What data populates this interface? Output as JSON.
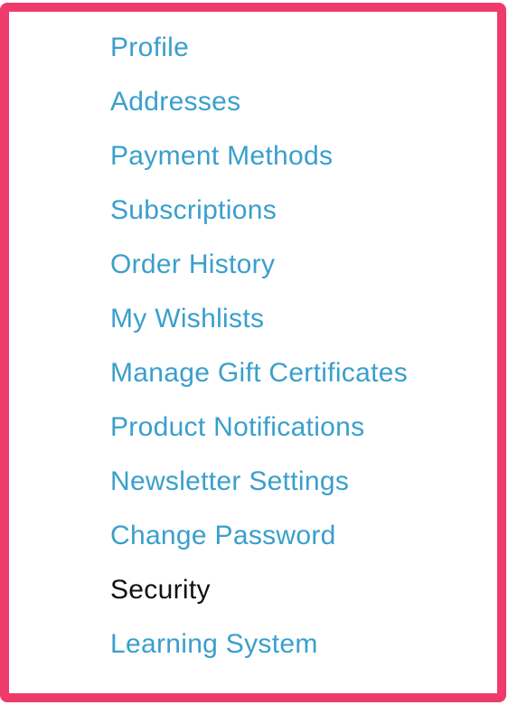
{
  "colors": {
    "frame_border": "#ef3a6c",
    "link": "#3a9fcc",
    "active": "#111111"
  },
  "account_menu": {
    "items": [
      {
        "label": "Profile",
        "active": false
      },
      {
        "label": "Addresses",
        "active": false
      },
      {
        "label": "Payment Methods",
        "active": false
      },
      {
        "label": "Subscriptions",
        "active": false
      },
      {
        "label": "Order History",
        "active": false
      },
      {
        "label": "My Wishlists",
        "active": false
      },
      {
        "label": "Manage Gift Certificates",
        "active": false
      },
      {
        "label": "Product Notifications",
        "active": false
      },
      {
        "label": "Newsletter Settings",
        "active": false
      },
      {
        "label": "Change Password",
        "active": false
      },
      {
        "label": "Security",
        "active": true
      },
      {
        "label": "Learning System",
        "active": false
      }
    ]
  }
}
